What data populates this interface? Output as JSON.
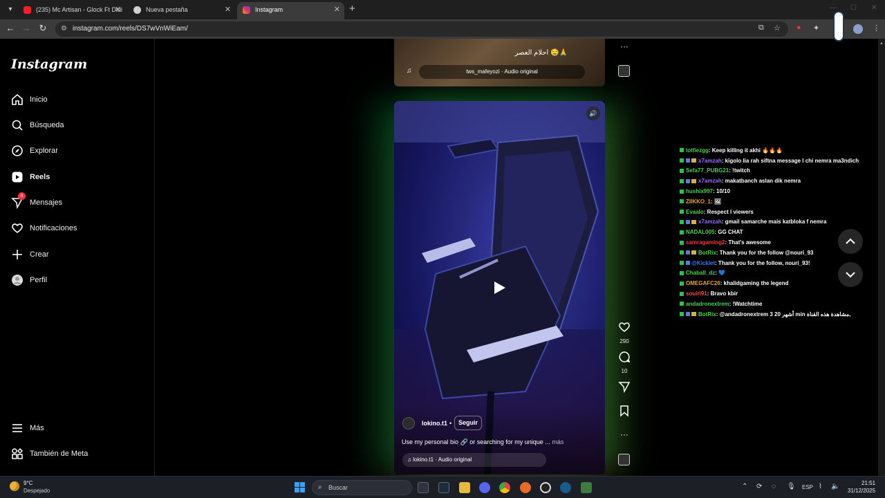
{
  "browser": {
    "tabs": [
      {
        "title": "(235) Mc Artisan - Glock Ft Didi",
        "favicon_color": "#ff1e1e"
      },
      {
        "title": "Nueva pestaña",
        "favicon_color": "#cfcfcf"
      },
      {
        "title": "Instagram",
        "favicon_color": "#e1306c"
      }
    ],
    "new_tab": "+",
    "url": "instagram.com/reels/DS7wVnWiEam/"
  },
  "sidebar": {
    "logo": "Instagram",
    "items": [
      {
        "label": "Inicio",
        "icon": "home-icon"
      },
      {
        "label": "Búsqueda",
        "icon": "search-icon"
      },
      {
        "label": "Explorar",
        "icon": "compass-icon"
      },
      {
        "label": "Reels",
        "icon": "reels-icon"
      },
      {
        "label": "Mensajes",
        "icon": "messenger-icon",
        "badge": "4"
      },
      {
        "label": "Notificaciones",
        "icon": "heart-icon"
      },
      {
        "label": "Crear",
        "icon": "plus-icon"
      },
      {
        "label": "Perfil",
        "icon": "avatar-icon"
      }
    ],
    "more": "Más",
    "meta": "También de Meta"
  },
  "reel_prev": {
    "caption": "احلام العصر 🤤🙏",
    "audio": "tws_mafeyozi · Audio original"
  },
  "reel": {
    "author": "lokino.t1",
    "dot": "•",
    "follow": "Seguir",
    "description": "Use my personal bio 🔗 or searching for my unique ...",
    "more": "más",
    "audio": "lokino.t1 · Audio original",
    "likes": "290",
    "comments": "10",
    "more_menu": "···"
  },
  "chat": [
    {
      "user": "lotfiezgg",
      "color": "#4fd14f",
      "msg": " : Keep killing it akhi 🔥🔥🔥",
      "badges": 1
    },
    {
      "user": "x7amzah",
      "color": "#9b6bff",
      "msg": " : kigolo lia rah siftna message l chi nemra ma3ndich",
      "badges": 3
    },
    {
      "user": "Sefa77_PUBG21",
      "color": "#4fd14f",
      "msg": " : !twitch",
      "badges": 1
    },
    {
      "user": "x7amzah",
      "color": "#9b6bff",
      "msg": " : makatbanch aslan dik nemra",
      "badges": 3
    },
    {
      "user": "hushix997",
      "color": "#4fd14f",
      "msg": " : 10/10",
      "badges": 1
    },
    {
      "user": "ZIIKKO_1",
      "color": "#f0a030",
      "msg": " : 🖼",
      "badges": 1
    },
    {
      "user": "Evaalo",
      "color": "#4fd14f",
      "msg": " : Respect l viewers",
      "badges": 1
    },
    {
      "user": "x7amzah",
      "color": "#9b6bff",
      "msg": " : gmail samarche mais katbloka f nemra",
      "badges": 3
    },
    {
      "user": "NADAL005",
      "color": "#4fd14f",
      "msg": " : GG CHAT",
      "badges": 1
    },
    {
      "user": "samragaming2",
      "color": "#ff3a3a",
      "msg": " : That's awesome",
      "badges": 1
    },
    {
      "user": "BotRix",
      "color": "#4fd14f",
      "msg": " : Thank you for the follow @nouri_93",
      "badges": 3
    },
    {
      "user": "@Kicklet",
      "color": "#3a7bff",
      "msg": " : Thank you for the follow, nouri_93!",
      "badges": 2
    },
    {
      "user": "Chaball_dz",
      "color": "#4fd14f",
      "msg": " : 💙",
      "badges": 1
    },
    {
      "user": "OMEGAFC26",
      "color": "#f0a030",
      "msg": " : khalidgaming the legend",
      "badges": 1
    },
    {
      "user": "souiri91",
      "color": "#ff4a4a",
      "msg": " : Bravo kbir",
      "badges": 1
    },
    {
      "user": "andadronextrem",
      "color": "#4fd14f",
      "msg": " : !Watchtime",
      "badges": 1
    },
    {
      "user": "BotRix",
      "color": "#4fd14f",
      "msg": " : @andadronextrem 3 أشهر 20 min مشاهدة هذه القناة,",
      "badges": 3
    }
  ],
  "taskbar": {
    "temp": "9°C",
    "weather": "Despejado",
    "search_placeholder": "Buscar",
    "lang": "ESP",
    "time": "21:51",
    "date": "31/12/2025",
    "apps": [
      "file-explorer-icon",
      "edge-icon",
      "folder-icon",
      "discord-icon",
      "chrome-icon",
      "mic-app-icon",
      "obs-icon",
      "steam-icon",
      "game-icon"
    ]
  }
}
